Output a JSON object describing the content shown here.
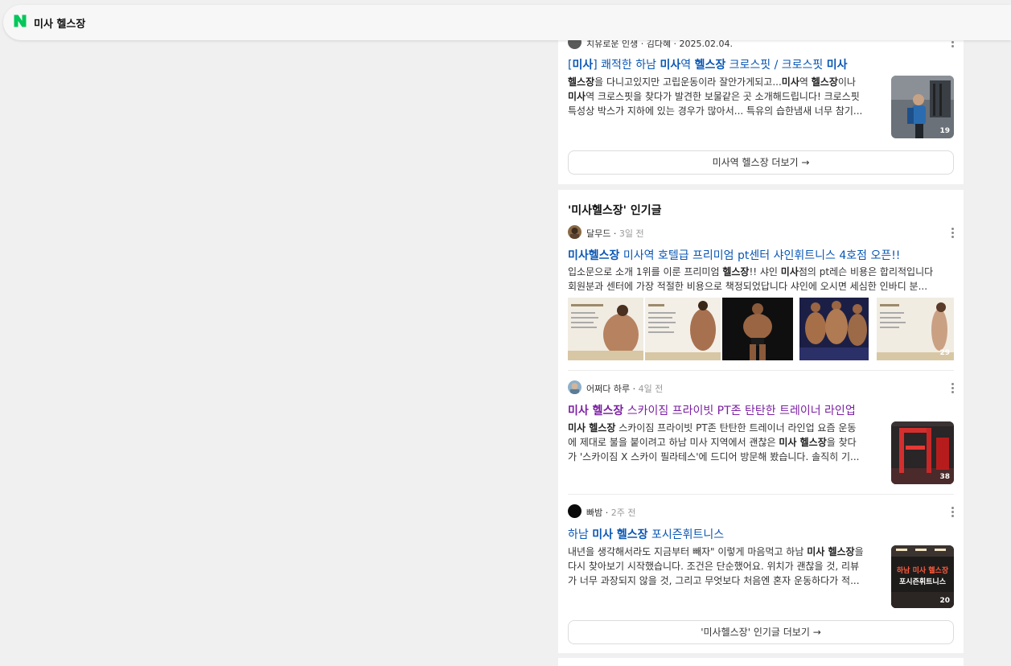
{
  "search": {
    "query": "미사 헬스장"
  },
  "card_top": {
    "partial_meta": "치유로운 인생 · 김다혜 · 2025.02.04.",
    "post": {
      "title_parts": [
        {
          "t": "[",
          "b": false
        },
        {
          "t": "미사",
          "b": true
        },
        {
          "t": "] 쾌적한 하남 ",
          "b": false
        },
        {
          "t": "미사",
          "b": true
        },
        {
          "t": "역 ",
          "b": false
        },
        {
          "t": "헬스장",
          "b": true
        },
        {
          "t": " 크로스핏 / 크로스핏 ",
          "b": false
        },
        {
          "t": "미사",
          "b": true
        }
      ],
      "snippet_lines": [
        [
          {
            "t": "헬스장",
            "b": true
          },
          {
            "t": "을 다니고있지만 고립운동이라 잘안가게되고...",
            "b": false
          },
          {
            "t": "미사",
            "b": true
          },
          {
            "t": "역 ",
            "b": false
          },
          {
            "t": "헬스장",
            "b": true
          },
          {
            "t": "이나",
            "b": false
          }
        ],
        [
          {
            "t": "미사",
            "b": true
          },
          {
            "t": "역 크로스핏을 찾다가 발견한 보물같은 곳 소개해드립니다! 크로스핏",
            "b": false
          }
        ],
        [
          {
            "t": "특성상 박스가 지하에 있는 경우가 많아서... 특유의 습한냄새 너무 참기...",
            "b": false
          }
        ]
      ],
      "image_count": "19"
    },
    "more_button": "미사역 헬스장 더보기 →"
  },
  "popular": {
    "heading": "'미사헬스장' 인기글",
    "posts": [
      {
        "author": "달무드",
        "time": "3일 전",
        "title_parts": [
          {
            "t": "미사헬스장",
            "b": true
          },
          {
            "t": " 미사역 호텔급 프리미엄 pt센터 샤인휘트니스 4호점 오픈!!",
            "b": false
          }
        ],
        "snippet_lines": [
          [
            {
              "t": "입소문으로 소개 1위를 이룬 프리미엄 ",
              "b": false
            },
            {
              "t": "헬스장",
              "b": true
            },
            {
              "t": "!! 샤인 ",
              "b": false
            },
            {
              "t": "미사",
              "b": true
            },
            {
              "t": "점의 pt레슨 비용은 합리적입니다",
              "b": false
            }
          ],
          [
            {
              "t": "회원분과 센터에 가장 적절한 비용으로 책정되었답니다 샤인에 오시면 세심한 인바디 분...",
              "b": false
            }
          ]
        ],
        "image_count": "29"
      },
      {
        "author": "어쩌다 하루",
        "time": "4일 전",
        "title_parts": [
          {
            "t": "미사 ",
            "b": true
          },
          {
            "t": "헬스장",
            "b": true
          },
          {
            "t": " 스카이짐 프라이빗 PT존 탄탄한 트레이너 라인업",
            "b": false
          }
        ],
        "snippet_lines": [
          [
            {
              "t": "미사 헬스장",
              "b": true
            },
            {
              "t": " 스카이짐 프라이빗 PT존 탄탄한 트레이너 라인업 요즘 운동",
              "b": false
            }
          ],
          [
            {
              "t": "에 제대로 불을 붙이려고 하남 미사 지역에서 괜찮은 ",
              "b": false
            },
            {
              "t": "미사 헬스장",
              "b": true
            },
            {
              "t": "을 찾다",
              "b": false
            }
          ],
          [
            {
              "t": "가 '스카이짐 X 스카이 필라테스'에 드디어 방문해 봤습니다. 솔직히 기...",
              "b": false
            }
          ]
        ],
        "image_count": "38"
      },
      {
        "author": "빠밤",
        "time": "2주 전",
        "title_parts": [
          {
            "t": "하남 ",
            "b": false
          },
          {
            "t": "미사 헬스장",
            "b": true
          },
          {
            "t": " 포시즌휘트니스",
            "b": false
          }
        ],
        "snippet_lines": [
          [
            {
              "t": "내년을 생각해서라도 지금부터 빼자\" 이렇게 마음먹고 하남 ",
              "b": false
            },
            {
              "t": "미사 헬스장",
              "b": true
            },
            {
              "t": "을",
              "b": false
            }
          ],
          [
            {
              "t": "다시 찾아보기 시작했습니다. 조건은 단순했어요. 위치가 괜찮을 것, 리뷰",
              "b": false
            }
          ],
          [
            {
              "t": "가 너무 과장되지 않을 것, 그리고 무엇보다 처음엔 혼자 운동하다가 적...",
              "b": false
            }
          ]
        ],
        "thumb_text": [
          "하남 미사 헬스장",
          "포시즌휘트니스"
        ],
        "image_count": "20"
      }
    ],
    "more_button": "'미사헬스장' 인기글 더보기 →"
  },
  "colors": {
    "naver_green": "#03c75a",
    "link_blue": "#0b57b4",
    "visited_purple": "#7b1fa2"
  }
}
